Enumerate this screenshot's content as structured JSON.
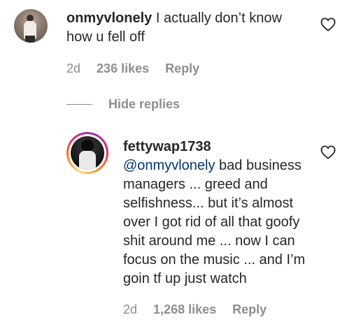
{
  "comment": {
    "username": "onmyvlonely",
    "text": "I actually don’t know how u fell off",
    "time": "2d",
    "likes": "236 likes",
    "reply_label": "Reply",
    "like_icon": "heart-outline-icon"
  },
  "hide_replies_label": "Hide replies",
  "reply": {
    "username": "fettywap1738",
    "mention": "@onmyvlonely",
    "text": "bad business managers ... greed and selfishness... but it’s almost over I got rid of all that goofy shit around me ... now I can focus on the music ... and I’m goin tf up just watch",
    "time": "2d",
    "likes": "1,268 likes",
    "reply_label": "Reply",
    "like_icon": "heart-outline-icon",
    "story_ring": true
  },
  "colors": {
    "text": "#262626",
    "secondary": "#8e8e8e",
    "mention": "#00376b"
  }
}
